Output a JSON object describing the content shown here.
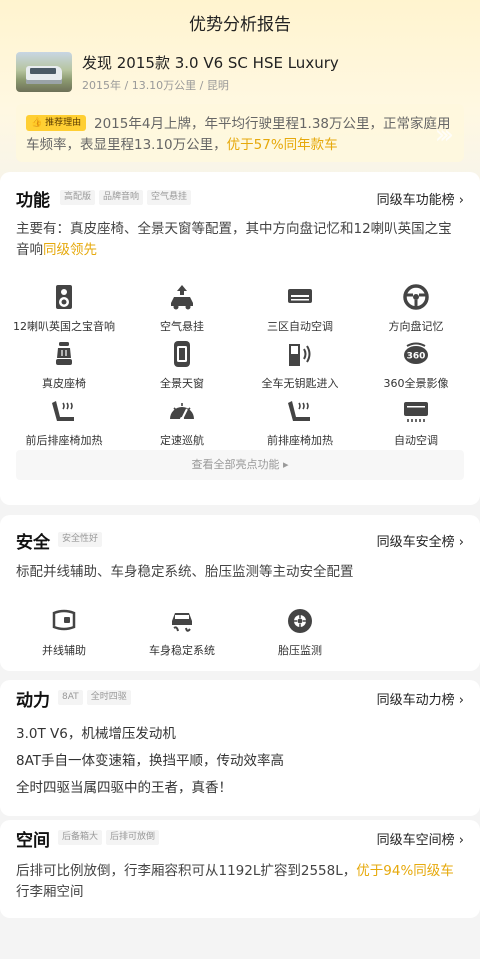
{
  "header": {
    "title": "优势分析报告"
  },
  "car": {
    "name": "发现 2015款 3.0 V6 SC HSE Luxury",
    "meta": "2015年 / 13.10万公里 / 昆明"
  },
  "reason": {
    "tag": "推荐理由",
    "text": "2015年4月上牌，年平均行驶里程1.38万公里，正常家庭用车频率，表显里程13.10万公里，",
    "highlight": "优于57%同年款车"
  },
  "features": {
    "title": "功能",
    "chips": [
      "高配版",
      "品牌音响",
      "空气悬挂"
    ],
    "rank_link": "同级车功能榜 ›",
    "desc": "主要有：真皮座椅、全景天窗等配置，其中方向盘记忆和12喇叭英国之宝音响",
    "desc_highlight": "同级领先",
    "items": [
      {
        "label": "12喇叭英国之宝音响",
        "icon": "speaker-icon"
      },
      {
        "label": "空气悬挂",
        "icon": "air-suspension-icon"
      },
      {
        "label": "三区自动空调",
        "icon": "tri-zone-ac-icon"
      },
      {
        "label": "方向盘记忆",
        "icon": "steering-wheel-icon"
      },
      {
        "label": "真皮座椅",
        "icon": "leather-seat-icon"
      },
      {
        "label": "全景天窗",
        "icon": "sunroof-icon"
      },
      {
        "label": "全车无钥匙进入",
        "icon": "keyless-entry-icon"
      },
      {
        "label": "360全景影像",
        "icon": "camera-360-icon"
      },
      {
        "label": "前后排座椅加热",
        "icon": "seat-heat-icon"
      },
      {
        "label": "定速巡航",
        "icon": "cruise-control-icon"
      },
      {
        "label": "前排座椅加热",
        "icon": "front-seat-heat-icon"
      },
      {
        "label": "自动空调",
        "icon": "auto-ac-icon"
      }
    ],
    "view_all": "查看全部亮点功能 ▸"
  },
  "safety": {
    "title": "安全",
    "chips": [
      "安全性好"
    ],
    "rank_link": "同级车安全榜 ›",
    "desc": "标配并线辅助、车身稳定系统、胎压监测等主动安全配置",
    "items": [
      {
        "label": "并线辅助",
        "icon": "lane-assist-icon"
      },
      {
        "label": "车身稳定系统",
        "icon": "stability-icon"
      },
      {
        "label": "胎压监测",
        "icon": "tire-pressure-icon"
      }
    ]
  },
  "power": {
    "title": "动力",
    "chips": [
      "8AT",
      "全时四驱"
    ],
    "rank_link": "同级车动力榜 ›",
    "lines": [
      "3.0T V6，机械增压发动机",
      "8AT手自一体变速箱，换挡平顺，传动效率高",
      "全时四驱当属四驱中的王者，真香！"
    ]
  },
  "space": {
    "title": "空间",
    "chips": [
      "后备箱大",
      "后排可放倒"
    ],
    "rank_link": "同级车空间榜 ›",
    "desc": "后排可比例放倒，行李厢容积可从1192L扩容到2558L，",
    "desc_highlight": "优于94%同级车",
    "desc_tail": "行李厢空间"
  }
}
